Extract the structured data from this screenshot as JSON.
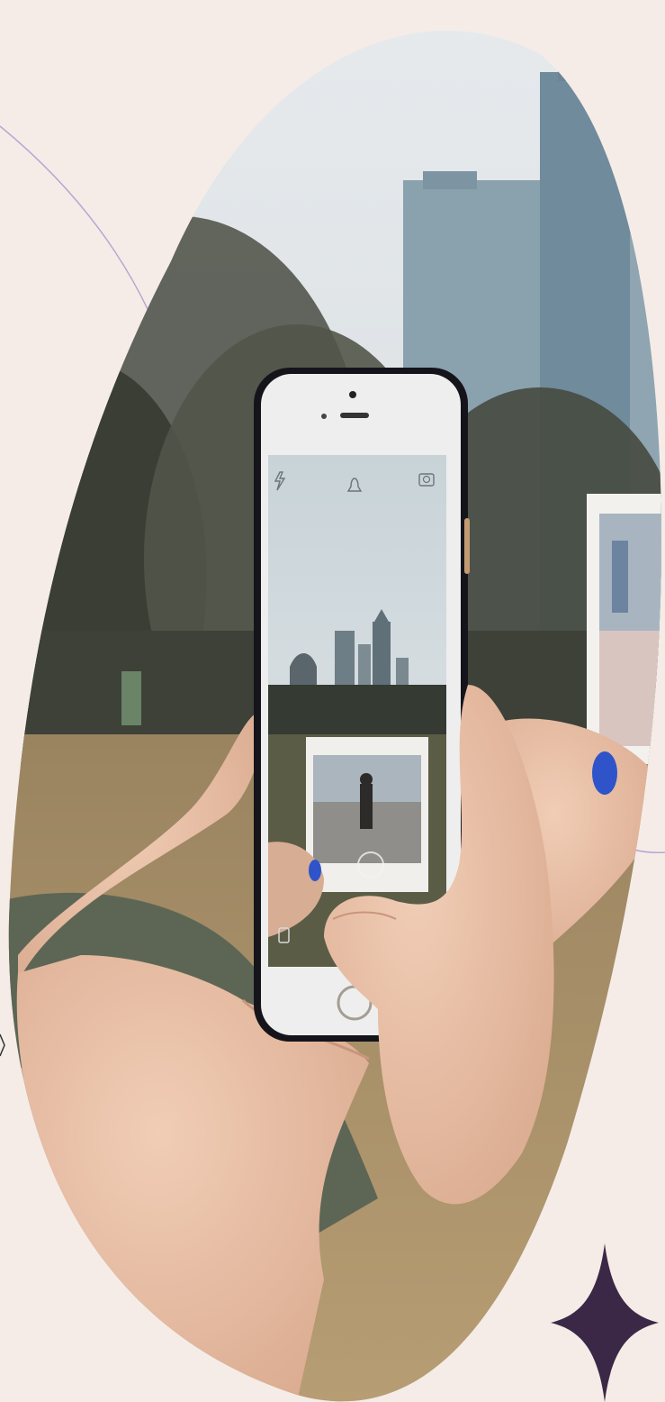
{
  "colors": {
    "page_background": "#f5ece7",
    "decorative_line": "#b9a6d2",
    "sparkle": "#3b2847",
    "sky": "#d9dfe4",
    "building": "#7f98a8",
    "trees": "#3f4338",
    "field": "#a8906a",
    "phone_body": "#eeeeee",
    "phone_case": "#15141b",
    "skin": "#e8bfa6",
    "nail_polish": "#2f54c9",
    "jacket": "#5d6655"
  },
  "icons": {
    "flash": "flash-icon",
    "ghost": "snapchat-ghost-icon",
    "camera_flip": "camera-flip-icon",
    "gallery": "gallery-icon",
    "shutter": "shutter-icon",
    "home_button": "home-button-icon"
  }
}
